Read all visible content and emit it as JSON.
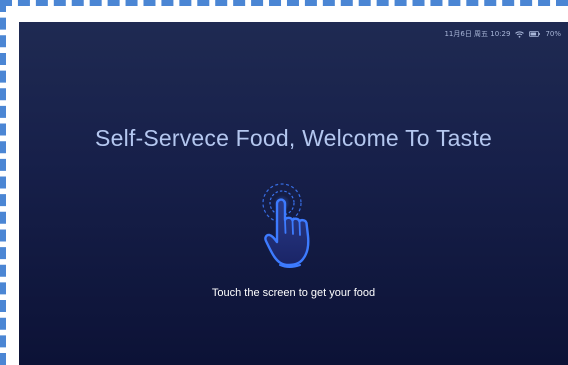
{
  "status_bar": {
    "date_time": "11月6日 周五 10:29",
    "battery_percent": "70%",
    "wifi_icon": "wifi-icon",
    "battery_icon": "battery-icon"
  },
  "main": {
    "headline": "Self-Servece Food, Welcome To Taste",
    "touch_icon": "touch-hand-icon",
    "instruction": "Touch the screen to get your food"
  },
  "colors": {
    "background_top": "#1f2a52",
    "background_bottom": "#0c1236",
    "accent": "#3d7bff",
    "headline": "#b4c7ef"
  }
}
